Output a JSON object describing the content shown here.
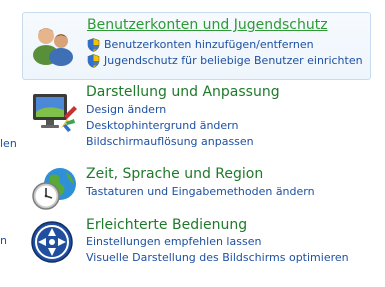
{
  "edge_fragments": {
    "top": "len",
    "bottom": "n"
  },
  "categories": [
    {
      "icon": "users-icon",
      "title": "Benutzerkonten und Jugendschutz",
      "links": [
        {
          "label": "Benutzerkonten hinzufügen/entfernen",
          "icon": "uac-shield-icon"
        },
        {
          "label": "Jugendschutz für beliebige Benutzer einrichten",
          "icon": "uac-shield-icon"
        }
      ]
    },
    {
      "icon": "appearance-icon",
      "title": "Darstellung und Anpassung",
      "links": [
        {
          "label": "Design ändern"
        },
        {
          "label": "Desktophintergrund ändern"
        },
        {
          "label": "Bildschirmauflösung anpassen"
        }
      ]
    },
    {
      "icon": "clock-globe-icon",
      "title": "Zeit, Sprache und Region",
      "links": [
        {
          "label": "Tastaturen und Eingabemethoden ändern"
        }
      ]
    },
    {
      "icon": "ease-of-access-icon",
      "title": "Erleichterte Bedienung",
      "links": [
        {
          "label": "Einstellungen empfehlen lassen"
        },
        {
          "label": "Visuelle Darstellung des Bildschirms optimieren"
        }
      ]
    }
  ]
}
